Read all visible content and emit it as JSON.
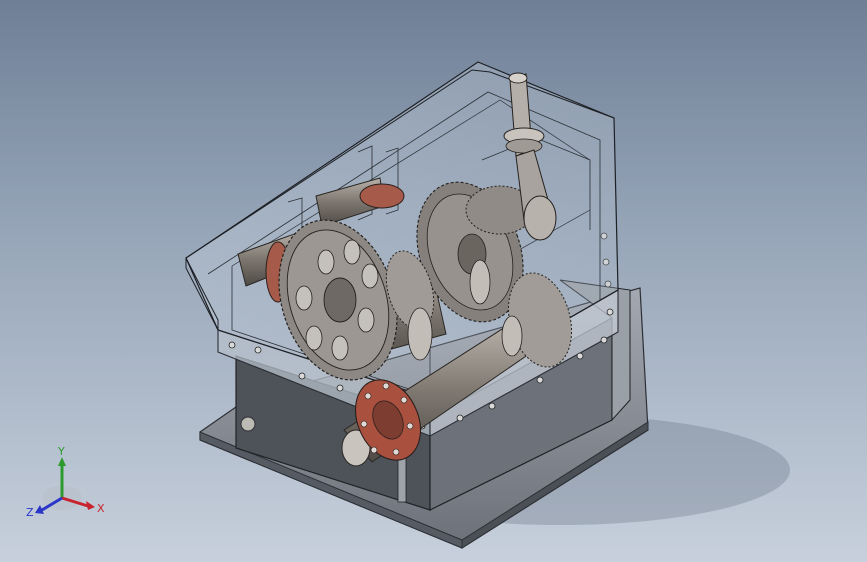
{
  "view": {
    "triad": {
      "x_label": "X",
      "y_label": "Y",
      "z_label": "Z",
      "x_color": "#c8232c",
      "y_color": "#2e9a2e",
      "z_color": "#2a36c8"
    }
  },
  "colors": {
    "background_top": "#6f7f96",
    "background_bottom": "#c7d0dc",
    "housing_glass": "#c9d3df",
    "gear_metal": "#8c8782",
    "flange_red": "#b5503e",
    "base_plate": "#8c919a"
  }
}
